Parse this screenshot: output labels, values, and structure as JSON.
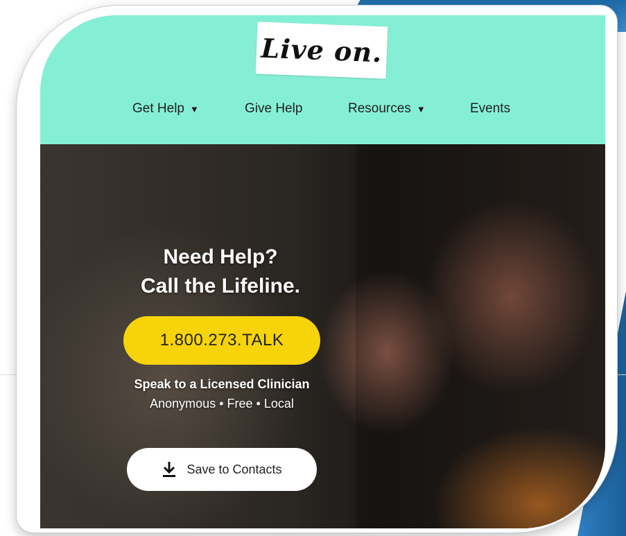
{
  "header": {
    "logo_text": "Live on.",
    "nav": [
      {
        "label": "Get Help",
        "has_dropdown": true
      },
      {
        "label": "Give Help",
        "has_dropdown": false
      },
      {
        "label": "Resources",
        "has_dropdown": true
      },
      {
        "label": "Events",
        "has_dropdown": false
      }
    ],
    "background_color": "#85efd6"
  },
  "hero": {
    "title_line1": "Need Help?",
    "title_line2": "Call the Lifeline.",
    "call_button_label": "1.800.273.TALK",
    "subtitle": "Speak to a Licensed Clinician",
    "features": "Anonymous • Free • Local",
    "save_button_label": "Save to Contacts",
    "call_button_color": "#f7d40a"
  },
  "icons": {
    "dropdown": "caret-down-icon",
    "save": "download-icon"
  }
}
